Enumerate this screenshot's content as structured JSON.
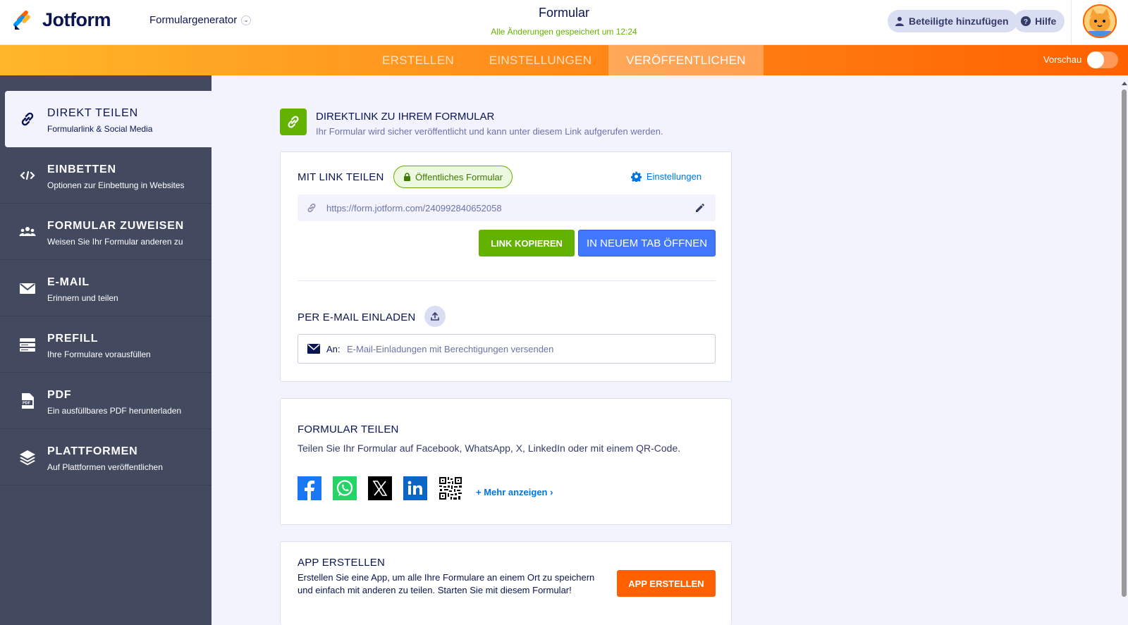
{
  "header": {
    "brand": "Jotform",
    "form_builder": "Formulargenerator",
    "title": "Formular",
    "saved_status": "Alle Änderungen gespeichert um 12:24",
    "add_participants": "Beteiligte hinzufügen",
    "help": "Hilfe"
  },
  "nav": {
    "tabs": [
      {
        "label": "ERSTELLEN"
      },
      {
        "label": "EINSTELLUNGEN"
      },
      {
        "label": "VERÖFFENTLICHEN"
      }
    ],
    "preview_label": "Vorschau"
  },
  "sidebar": {
    "items": [
      {
        "title": "DIREKT TEILEN",
        "subtitle": "Formularlink & Social Media",
        "icon": "link-icon"
      },
      {
        "title": "EINBETTEN",
        "subtitle": "Optionen zur Einbettung in Websites",
        "icon": "code-icon"
      },
      {
        "title": "FORMULAR ZUWEISEN",
        "subtitle": "Weisen Sie Ihr Formular anderen zu",
        "icon": "users-icon"
      },
      {
        "title": "E-MAIL",
        "subtitle": "Erinnern und teilen",
        "icon": "envelope-icon"
      },
      {
        "title": "PREFILL",
        "subtitle": "Ihre Formulare vorausfüllen",
        "icon": "prefill-icon"
      },
      {
        "title": "PDF",
        "subtitle": "Ein ausfüllbares PDF herunterladen",
        "icon": "pdf-icon"
      },
      {
        "title": "PLATTFORMEN",
        "subtitle": "Auf Plattformen veröffentlichen",
        "icon": "layers-icon"
      }
    ]
  },
  "main": {
    "section_title": "DIREKTLINK ZU IHREM FORMULAR",
    "section_subtitle": "Ihr Formular wird sicher veröffentlicht und kann unter diesem Link aufgerufen werden.",
    "link_card": {
      "title": "MIT LINK TEILEN",
      "status_badge": "Öffentliches Formular",
      "settings_label": "Einstellungen",
      "url": "https://form.jotform.com/240992840652058",
      "copy_button": "LINK KOPIEREN",
      "open_button": "IN NEUEM TAB ÖFFNEN",
      "invite_title": "PER E-MAIL EINLADEN",
      "to_label": "An:",
      "email_placeholder": "E-Mail-Einladungen mit Berechtigungen versenden"
    },
    "share_card": {
      "title": "FORMULAR TEILEN",
      "description": "Teilen Sie Ihr Formular auf Facebook, WhatsApp, X, LinkedIn oder mit einem QR-Code.",
      "icons": [
        "facebook-icon",
        "whatsapp-icon",
        "x-icon",
        "linkedin-icon",
        "qr-code-icon"
      ],
      "more_label": "+ Mehr anzeigen ›"
    },
    "app_card": {
      "title": "APP ERSTELLEN",
      "description": "Erstellen Sie eine App, um alle Ihre Formulare an einem Ort zu speichern und einfach mit anderen zu teilen. Starten Sie mit diesem Formular!",
      "button": "APP ERSTELLEN"
    }
  },
  "colors": {
    "brand_navy": "#0a1551",
    "accent_orange": "#ff6100",
    "success_green": "#64b200",
    "primary_blue": "#4277ff",
    "sidebar_bg": "#434a60"
  }
}
